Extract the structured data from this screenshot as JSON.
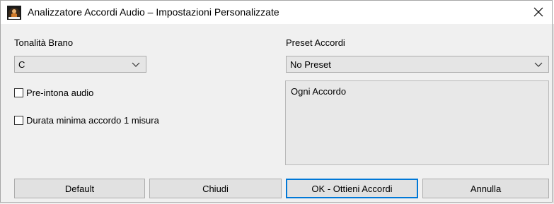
{
  "window": {
    "title": "Analizzatore Accordi Audio – Impostazioni Personalizzate",
    "app_icon": "piano-player-icon",
    "close_icon": "close-icon"
  },
  "key": {
    "label": "Tonalità Brano",
    "value": "C"
  },
  "preset": {
    "label": "Preset Accordi",
    "value": "No Preset"
  },
  "options": {
    "pretune_label": "Pre-intona audio",
    "pretune_checked": false,
    "min_duration_label": "Durata minima accordo 1 misura",
    "min_duration_checked": false
  },
  "listbox": {
    "items": [
      "Ogni Accordo"
    ]
  },
  "buttons": {
    "default_label": "Default",
    "close_label": "Chiudi",
    "ok_label": "OK - Ottieni Accordi",
    "cancel_label": "Annulla"
  },
  "colors": {
    "focus_border": "#0078d7",
    "window_bg": "#f0f0f0"
  }
}
